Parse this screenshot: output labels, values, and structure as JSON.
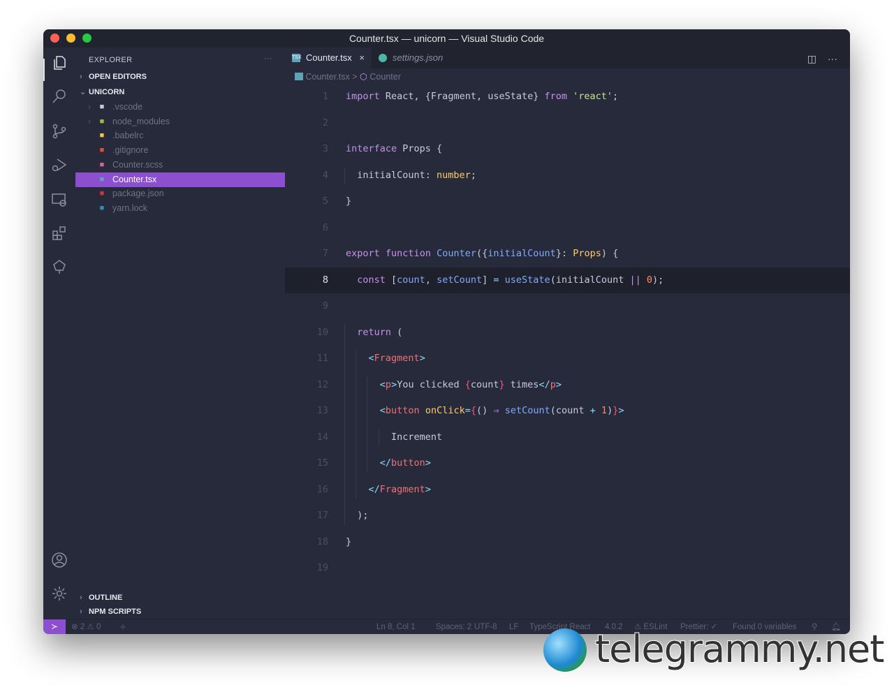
{
  "window": {
    "title": "Counter.tsx — unicorn — Visual Studio Code"
  },
  "sidebar": {
    "title": "EXPLORER",
    "more": "···",
    "sections": {
      "open_editors": "OPEN EDITORS",
      "project": "UNICORN",
      "outline": "OUTLINE",
      "npm_scripts": "NPM SCRIPTS"
    },
    "files": [
      {
        "name": ".vscode",
        "icon": "folder-icon",
        "folder": true,
        "color": "#c8ccd8"
      },
      {
        "name": "node_modules",
        "icon": "nodejs-icon",
        "folder": true,
        "color": "#8bc34a"
      },
      {
        "name": ".babelrc",
        "icon": "babel-icon",
        "color": "#f5c342"
      },
      {
        "name": ".gitignore",
        "icon": "git-icon",
        "color": "#e44d3a"
      },
      {
        "name": "Counter.scss",
        "icon": "sass-icon",
        "color": "#cd6799"
      },
      {
        "name": "Counter.tsx",
        "icon": "tsx-icon",
        "color": "#5fa3b8",
        "selected": true
      },
      {
        "name": "package.json",
        "icon": "npm-icon",
        "color": "#cb3837"
      },
      {
        "name": "yarn.lock",
        "icon": "yarn-icon",
        "color": "#2c8ebb"
      }
    ]
  },
  "tabs": [
    {
      "label": "Counter.tsx",
      "active": true,
      "close": "×"
    },
    {
      "label": "settings.json",
      "active": false
    }
  ],
  "breadcrumb": {
    "file": "Counter.tsx",
    "separator": ">",
    "symbol": "Counter"
  },
  "code": {
    "current_line": 8,
    "lines": [
      [
        [
          "k",
          "import"
        ],
        [
          "pl",
          " React, {Fragment, useState} "
        ],
        [
          "k",
          "from"
        ],
        [
          "pl",
          " "
        ],
        [
          "s",
          "'react'"
        ],
        [
          "pl",
          ";"
        ]
      ],
      [],
      [
        [
          "k",
          "interface"
        ],
        [
          "pl",
          " Props {"
        ]
      ],
      [
        [
          "pl",
          "  initialCount: "
        ],
        [
          "ty",
          "number"
        ],
        [
          "pl",
          ";"
        ]
      ],
      [
        [
          "pl",
          "}"
        ]
      ],
      [],
      [
        [
          "k",
          "export"
        ],
        [
          "pl",
          " "
        ],
        [
          "k",
          "function"
        ],
        [
          "pl",
          " "
        ],
        [
          "f",
          "Counter"
        ],
        [
          "pl",
          "({"
        ],
        [
          "f",
          "initialCount"
        ],
        [
          "pl",
          "}: "
        ],
        [
          "ty",
          "Props"
        ],
        [
          "pl",
          ") {"
        ]
      ],
      [
        [
          "pl",
          "  "
        ],
        [
          "k",
          "const"
        ],
        [
          "pl",
          " ["
        ],
        [
          "f",
          "count"
        ],
        [
          "pl",
          ", "
        ],
        [
          "f",
          "setCount"
        ],
        [
          "pl",
          "] "
        ],
        [
          "p",
          "="
        ],
        [
          "pl",
          " "
        ],
        [
          "f",
          "useState"
        ],
        [
          "pl",
          "(initialCount "
        ],
        [
          "k",
          "||"
        ],
        [
          "pl",
          " "
        ],
        [
          "n",
          "0"
        ],
        [
          "pl",
          ");"
        ]
      ],
      [],
      [
        [
          "pl",
          "  "
        ],
        [
          "k",
          "return"
        ],
        [
          "pl",
          " ("
        ]
      ],
      [
        [
          "pl",
          "    "
        ],
        [
          "p",
          "<"
        ],
        [
          "t",
          "Fragment"
        ],
        [
          "p",
          ">"
        ]
      ],
      [
        [
          "pl",
          "      "
        ],
        [
          "p",
          "<"
        ],
        [
          "t",
          "p"
        ],
        [
          "p",
          ">"
        ],
        [
          "pl",
          "You clicked "
        ],
        [
          "br",
          "{"
        ],
        [
          "pl",
          "count"
        ],
        [
          "br",
          "}"
        ],
        [
          "pl",
          " times"
        ],
        [
          "p",
          "</"
        ],
        [
          "t",
          "p"
        ],
        [
          "p",
          ">"
        ]
      ],
      [
        [
          "pl",
          "      "
        ],
        [
          "p",
          "<"
        ],
        [
          "t",
          "button"
        ],
        [
          "pl",
          " "
        ],
        [
          "a",
          "onClick"
        ],
        [
          "p",
          "="
        ],
        [
          "br",
          "{"
        ],
        [
          "pl",
          "() "
        ],
        [
          "k",
          "⇒"
        ],
        [
          "pl",
          " "
        ],
        [
          "f",
          "setCount"
        ],
        [
          "pl",
          "(count "
        ],
        [
          "p",
          "+"
        ],
        [
          "pl",
          " "
        ],
        [
          "n",
          "1"
        ],
        [
          "pl",
          ")"
        ],
        [
          "br",
          "}"
        ],
        [
          "p",
          ">"
        ]
      ],
      [
        [
          "pl",
          "        Increment"
        ]
      ],
      [
        [
          "pl",
          "      "
        ],
        [
          "p",
          "</"
        ],
        [
          "t",
          "button"
        ],
        [
          "p",
          ">"
        ]
      ],
      [
        [
          "pl",
          "    "
        ],
        [
          "p",
          "</"
        ],
        [
          "t",
          "Fragment"
        ],
        [
          "p",
          ">"
        ]
      ],
      [
        [
          "pl",
          "  );"
        ]
      ],
      [
        [
          "pl",
          "}"
        ]
      ],
      []
    ]
  },
  "status": {
    "errors": "2",
    "warnings": "0",
    "position": "Ln 8, Col 1",
    "spaces": "Spaces: 2",
    "encoding": "UTF-8",
    "eol": "LF",
    "language": "TypeScript React",
    "version": "4.0.2",
    "eslint": "ESLint",
    "prettier": "Prettier: ✓",
    "variables": "Found 0 variables"
  },
  "watermark": "telegrammy.net"
}
